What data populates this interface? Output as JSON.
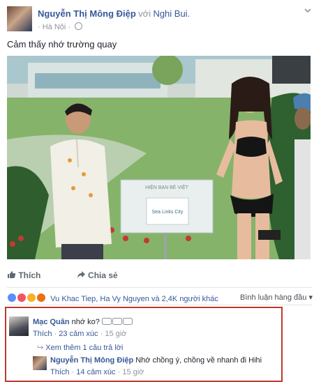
{
  "post": {
    "author": "Nguyễn Thị Mông Điệp",
    "with_text": "với",
    "tagged": "Nghi Bui.",
    "location": "Hà Nội",
    "message": "Cảm thấy nhớ trường quay",
    "sign_text": "Sea Links City",
    "sign_header": "HIỆN BẠN BÈ VIỆT",
    "actions": {
      "like": "Thích",
      "share": "Chia sẻ"
    },
    "reactions_text": "Vu Khac Tiep, Ha Vy Nguyen và 2,4K người khác",
    "ranking": "Bình luận hàng đầu"
  },
  "comments": [
    {
      "name": "Mạc Quân",
      "text": "nhớ ko? ",
      "like": "Thích",
      "reactions": "23 cảm xúc",
      "time": "15 giờ",
      "view_more": "Xem thêm 1 câu trả lời"
    },
    {
      "name": "Nguyễn Thị Mông Điệp",
      "text": "Nhớ chồng ý, chồng về nhanh đi Hihi",
      "like": "Thích",
      "reactions": "14 cảm xúc",
      "time": "15 giờ"
    }
  ],
  "colors": {
    "link": "#365899",
    "muted": "#90949c",
    "highlight_border": "#c0392b"
  }
}
